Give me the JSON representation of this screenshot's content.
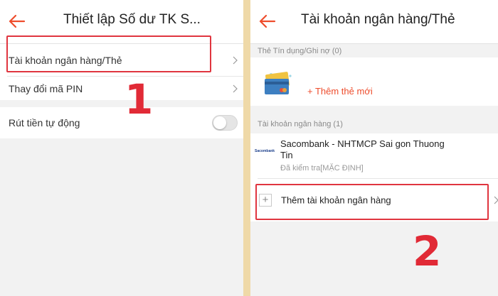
{
  "left": {
    "header": {
      "title": "Thiết lập Số dư TK S..."
    },
    "items": [
      {
        "label": "Tài khoản ngân hàng/Thẻ"
      },
      {
        "label": "Thay đổi mã PIN"
      },
      {
        "label": "Rút tiền tự động"
      }
    ],
    "auto_withdraw_enabled": false,
    "step_number": "1"
  },
  "right": {
    "header": {
      "title": "Tài khoản ngân hàng/Thẻ"
    },
    "cards_section": {
      "label": "Thẻ Tín dụng/Ghi nợ (0)",
      "add_label": "+ Thêm thẻ mới"
    },
    "bank_section": {
      "label": "Tài khoản ngân hàng (1)"
    },
    "bank": {
      "logo_text": "Sacombank",
      "name": "Sacombank - NHTMCP Sai gon Thuong Tin",
      "status": "Đã kiểm tra[MẶC ĐỊNH]"
    },
    "add_bank": {
      "icon": "+",
      "label": "Thêm tài khoản ngân hàng"
    },
    "step_number": "2"
  },
  "colors": {
    "accent": "#ee4d2d",
    "highlight": "#e0353f",
    "separator_bar": "#efd9a8"
  }
}
